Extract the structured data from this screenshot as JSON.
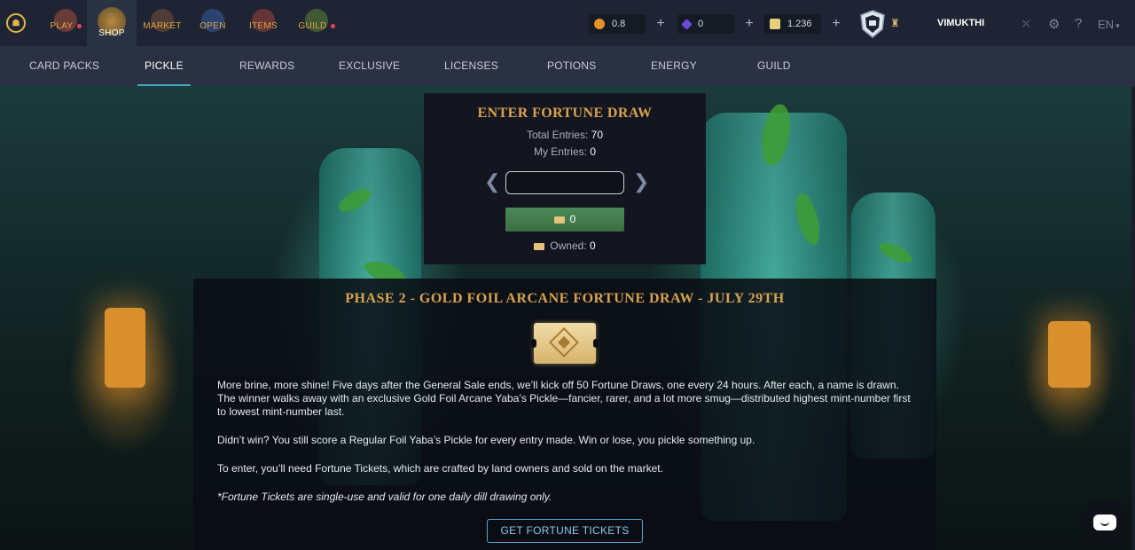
{
  "topbar": {
    "logo_icon": "splinterlands-logo-icon",
    "nav": [
      {
        "label": "PLAY",
        "has_dot": true,
        "icon": "play-icon"
      },
      {
        "label": "SHOP",
        "has_dot": false,
        "icon": "shop-icon",
        "active": true
      },
      {
        "label": "MARKET",
        "has_dot": false,
        "icon": "market-icon"
      },
      {
        "label": "OPEN",
        "has_dot": false,
        "icon": "open-icon"
      },
      {
        "label": "ITEMS",
        "has_dot": false,
        "icon": "items-icon"
      },
      {
        "label": "GUILD",
        "has_dot": true,
        "icon": "guild-icon"
      }
    ],
    "resources": [
      {
        "value": "0.8",
        "icon": "coin-icon",
        "color": "#e8902a"
      },
      {
        "value": "0",
        "icon": "gem-icon",
        "color": "#6a4bd6"
      },
      {
        "value": "1.236",
        "icon": "scroll-icon",
        "color": "#e8d07a"
      }
    ],
    "username": "VIMUKTHI",
    "language": "EN"
  },
  "subnav": [
    "CARD PACKS",
    "PICKLE",
    "REWARDS",
    "EXCLUSIVE",
    "LICENSES",
    "POTIONS",
    "ENERGY",
    "GUILD"
  ],
  "draw": {
    "title": "ENTER FORTUNE DRAW",
    "total_label": "Total Entries:",
    "total_value": "70",
    "mine_label": "My Entries:",
    "mine_value": "0",
    "input_value": "",
    "enter_value": "0",
    "owned_label": "Owned:",
    "owned_value": "0"
  },
  "info": {
    "title": "PHASE 2 - GOLD FOIL ARCANE FORTUNE DRAW - JULY 29TH",
    "p1": "More brine, more shine! Five days after the General Sale ends, we’ll kick off 50 Fortune Draws, one every 24 hours. After each, a name is drawn. The winner walks away with an exclusive Gold Foil Arcane Yaba’s Pickle—fancier, rarer, and a lot more smug—distributed highest mint-number first to lowest mint-number last.",
    "p2": "Didn’t win? You still score a Regular Foil Yaba’s Pickle for every entry made. Win or lose, you pickle something up.",
    "p3": "To enter, you’ll need Fortune Tickets, which are crafted by land owners and sold on the market.",
    "p4": "*Fortune Tickets are single-use and valid for one daily dill drawing only.",
    "cta": "GET FORTUNE TICKETS"
  },
  "colors": {
    "accent_gold": "#d9a24f",
    "accent_blue": "#5ba4c9",
    "enter_green": "#4c8a57"
  }
}
